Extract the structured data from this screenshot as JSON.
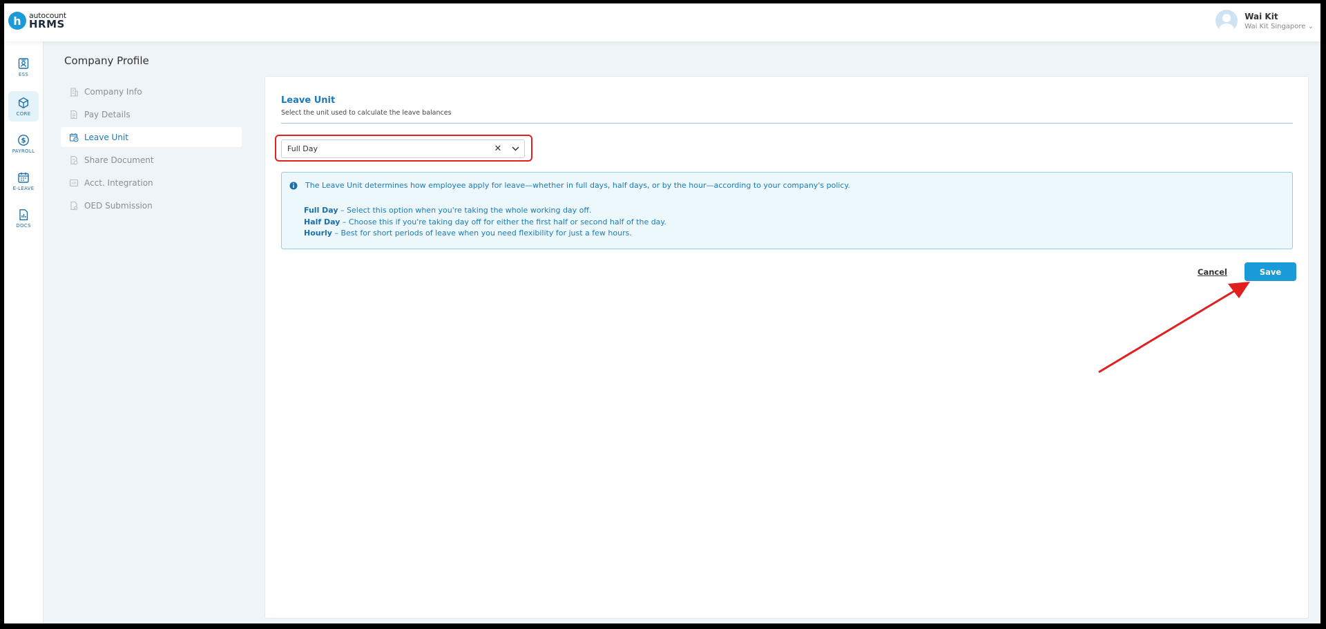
{
  "header": {
    "logo_letter": "h",
    "logo_top": "autocount",
    "logo_bottom": "HRMS",
    "user_name": "Wai Kit",
    "user_company": "Wai Kit Singapore ⌄"
  },
  "rail": [
    {
      "label": "ESS",
      "icon": "ess-icon"
    },
    {
      "label": "CORE",
      "icon": "core-icon"
    },
    {
      "label": "PAYROLL",
      "icon": "payroll-icon"
    },
    {
      "label": "E-LEAVE",
      "icon": "calendar-icon"
    },
    {
      "label": "DOCS",
      "icon": "docs-icon"
    }
  ],
  "page": {
    "title": "Company Profile"
  },
  "submenu": [
    {
      "label": "Company Info",
      "icon": "building-icon"
    },
    {
      "label": "Pay Details",
      "icon": "document-icon"
    },
    {
      "label": "Leave Unit",
      "icon": "calendar-clock-icon"
    },
    {
      "label": "Share Document",
      "icon": "share-document-icon"
    },
    {
      "label": "Acct. Integration",
      "icon": "integration-icon"
    },
    {
      "label": "OED Submission",
      "icon": "submission-icon"
    }
  ],
  "leave_unit": {
    "title": "Leave Unit",
    "subtitle": "Select the unit used to calculate the leave balances",
    "selected": "Full Day",
    "clear_symbol": "✕",
    "info_main": "The Leave Unit determines how employee apply for leave—whether in full days, half days, or by the hour—according to your company's policy.",
    "options": [
      {
        "name": "Full Day",
        "desc": " – Select this option when you're taking the whole working day off."
      },
      {
        "name": "Half Day",
        "desc": " – Choose this if you're taking day off for either the first half or second half of the day."
      },
      {
        "name": "Hourly",
        "desc": " – Best for short periods of leave when you need flexibility for just a few hours."
      }
    ],
    "cancel_label": "Cancel",
    "save_label": "Save"
  },
  "colors": {
    "accent": "#1a9ad6",
    "highlight": "#e0201f"
  }
}
